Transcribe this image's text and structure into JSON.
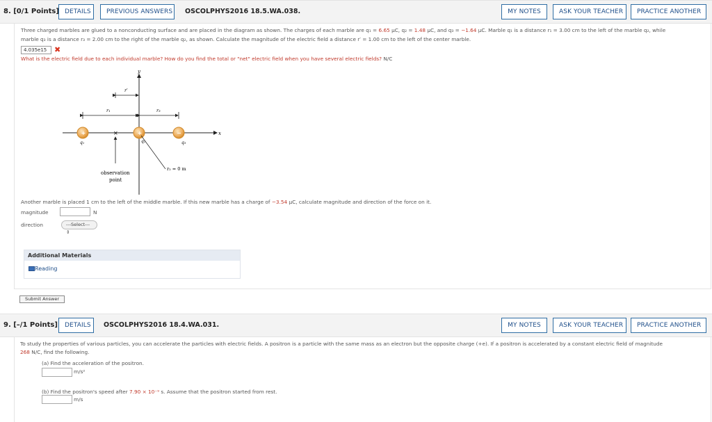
{
  "q8": {
    "number": "8.  [0/1 Points]",
    "details": "DETAILS",
    "previous_answers": "PREVIOUS ANSWERS",
    "code": "OSCOLPHYS2016 18.5.WA.038.",
    "my_notes": "MY NOTES",
    "ask_teacher": "ASK YOUR TEACHER",
    "practice_another": "PRACTICE ANOTHER",
    "text1": "Three charged marbles are glued to a nonconducting surface and are placed in the diagram as shown. The charges of each marble are q₁ = ",
    "q1_val": "6.65",
    "text1b": " μC, q₂ = ",
    "q2_val": "1.48",
    "text1c": " μC, and q₃ = ",
    "q3_val": "−1.64",
    "text1d": " μC.  Marble q₁ is a distance r₁ = 3.00 cm to the left of the marble q₂, while",
    "text2": "marble q₃ is a distance r₃ = 2.00 cm to the right of the marble q₂, as shown. Calculate the magnitude of the electric field a distance r′ = 1.00 cm to the left of the center marble.",
    "answer_value": "4.035e15",
    "hint": "What is the electric field due to each individual marble? How do you find the total or \"net\" electric field when you have several electric fields?",
    "unit_nc": " N/C",
    "diagram": {
      "y_label": "y",
      "x_label": "x",
      "rprime_label": "r′",
      "r1_label": "r₁",
      "r3_label": "r₃",
      "q1_label": "q₁",
      "q2_label": "q₂",
      "q3_label": "q₃",
      "plus": "+",
      "minus": "−",
      "obs_line1": "observation",
      "obs_line2": "point",
      "r2_label": "r₂ = 0 m"
    },
    "text3a": "Another marble is placed 1 cm to the left of the middle marble. If this new marble has a charge of  ",
    "charge_val": "−3.54",
    "text3b": " μC,  calculate magnitude and direction of the force on it.",
    "magnitude_label": "magnitude",
    "magnitude_unit": "N",
    "direction_label": "direction",
    "select_text": "---Select--- ⇕",
    "additional_materials": "Additional Materials",
    "reading": "Reading",
    "submit": "Submit Answer"
  },
  "q9": {
    "number": "9.  [–/1 Points]",
    "details": "DETAILS",
    "code": "OSCOLPHYS2016 18.4.WA.031.",
    "my_notes": "MY NOTES",
    "ask_teacher": "ASK YOUR TEACHER",
    "practice_another": "PRACTICE ANOTHER",
    "text1": "To study the properties of various particles, you can accelerate the particles with electric fields. A positron is a particle with the same mass as an electron but the opposite charge (+e). If a positron is accelerated by a constant electric field of magnitude",
    "field_val": "268",
    "text2": " N/C, find the following.",
    "part_a": "(a) Find the acceleration of the positron.",
    "unit_a": "m/s²",
    "part_b_pre": "(b) Find the positron's speed after ",
    "part_b_val": "7.90 × 10⁻⁹",
    "part_b_post": " s. Assume that the positron started from rest.",
    "unit_b": "m/s"
  },
  "colors": {
    "accent": "#2e6da4",
    "error": "#c0392b",
    "bar": "#f3f3f3"
  }
}
